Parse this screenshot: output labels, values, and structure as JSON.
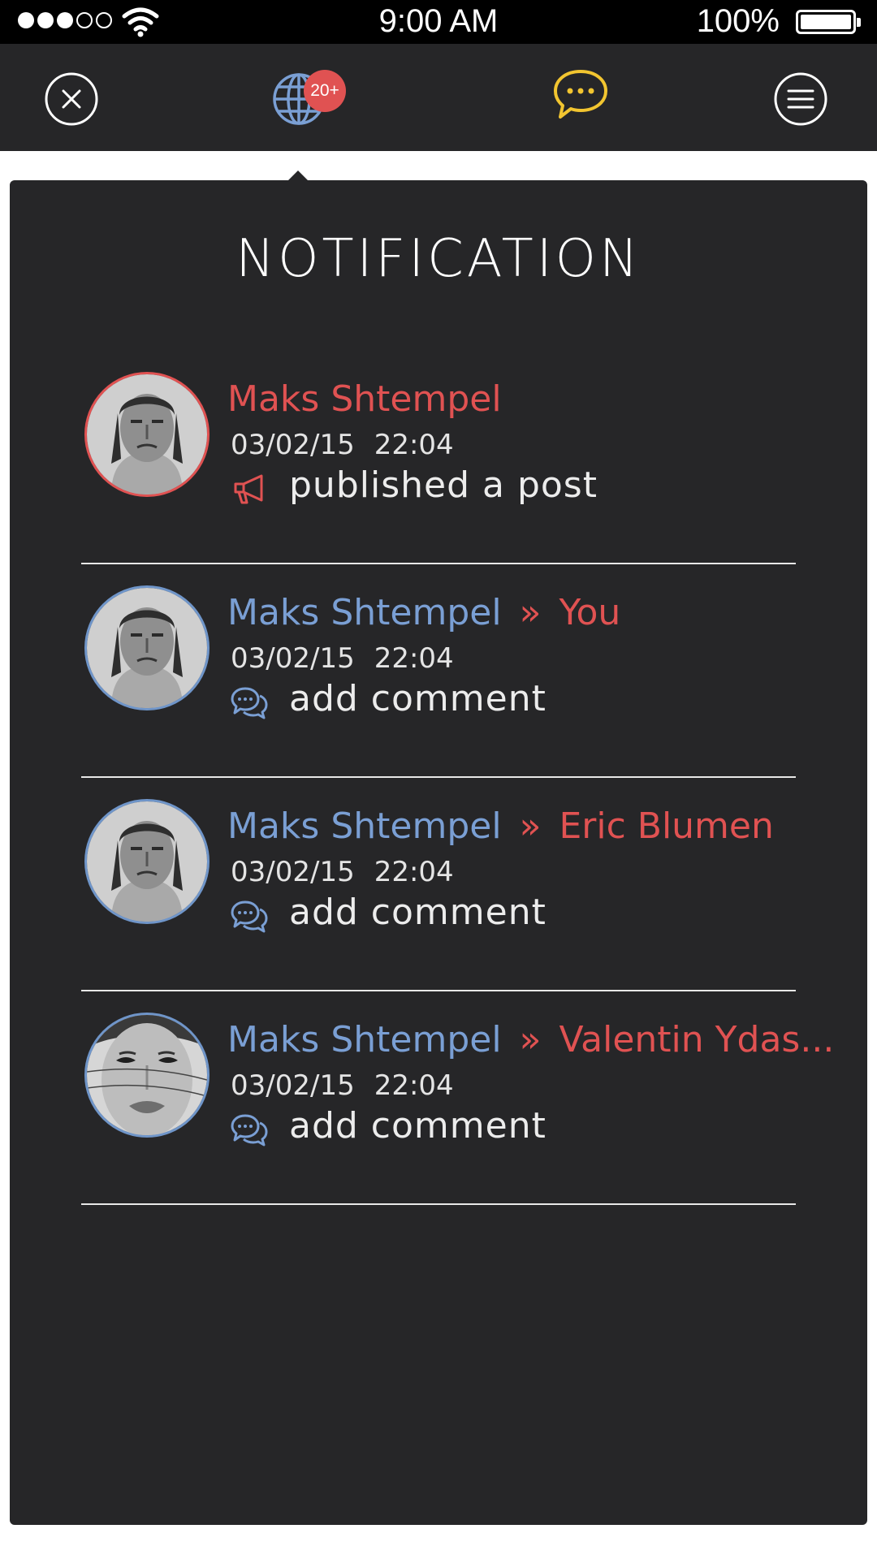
{
  "status_bar": {
    "signal_bars_on": 3,
    "signal_bars_total": 5,
    "time": "9:00 AM",
    "battery": "100%"
  },
  "nav": {
    "badge": "20+",
    "icons": [
      "close-icon",
      "globe-icon",
      "chat-icon",
      "menu-icon"
    ],
    "chat_color": "#f2c530"
  },
  "panel": {
    "title": "NOTIFICATION"
  },
  "notifications": [
    {
      "author": "Maks Shtempel",
      "target": "",
      "date": "03/02/15",
      "time": "22:04",
      "action": "published a post",
      "action_icon": "megaphone-icon",
      "avatar": "man-portrait"
    },
    {
      "author": "Maks Shtempel",
      "target": "You",
      "date": "03/02/15",
      "time": "22:04",
      "action": "add comment",
      "action_icon": "comment-icon",
      "avatar": "man-portrait"
    },
    {
      "author": "Maks Shtempel",
      "target": "Eric Blumen",
      "date": "03/02/15",
      "time": "22:04",
      "action": "add comment",
      "action_icon": "comment-icon",
      "avatar": "man-portrait"
    },
    {
      "author": "Maks Shtempel",
      "target": "Valentin Ydas...",
      "date": "03/02/15",
      "time": "22:04",
      "action": "add comment",
      "action_icon": "comment-icon",
      "avatar": "woman-portrait"
    }
  ],
  "colors": {
    "background": "#262628",
    "accent_red": "#e05252",
    "accent_blue": "#7a9fd4",
    "accent_yellow": "#f2c530"
  }
}
